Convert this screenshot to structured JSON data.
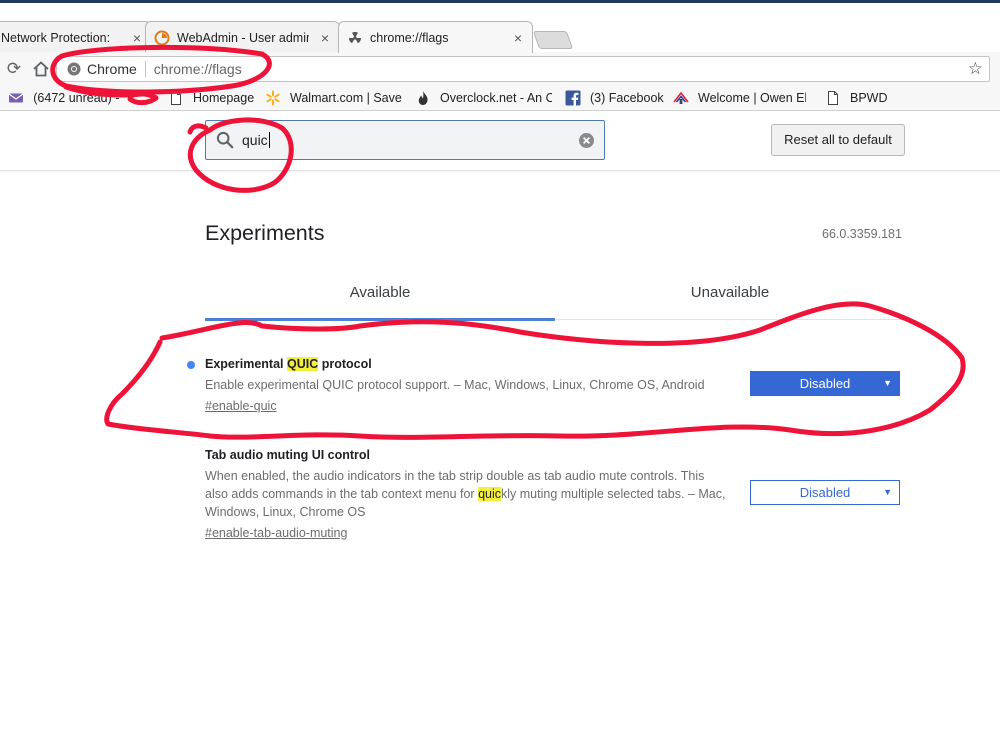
{
  "tabs": [
    {
      "title": "Network Protection: F",
      "close": "×"
    },
    {
      "title": "WebAdmin - User admin",
      "close": "×"
    },
    {
      "title": "chrome://flags",
      "close": "×"
    }
  ],
  "omnibox": {
    "site_label": "Chrome",
    "url": "chrome://flags"
  },
  "bookmarks": [
    {
      "label": "(6472 unread) -",
      "icon": "mail-icon"
    },
    {
      "label": "Homepage",
      "icon": "page-icon"
    },
    {
      "label": "Walmart.com | Save",
      "icon": "walmart-spark-icon"
    },
    {
      "label": "Overclock.net - An O",
      "icon": "flame-icon"
    },
    {
      "label": "(3) Facebook",
      "icon": "facebook-icon"
    },
    {
      "label": "Welcome | Owen Ele",
      "icon": "owen-logo-icon"
    },
    {
      "label": "BPWD",
      "icon": "page-icon"
    }
  ],
  "search": {
    "value": "quic"
  },
  "reset_label": "Reset all to default",
  "page": {
    "title": "Experiments",
    "version": "66.0.3359.181"
  },
  "flag_tabs": {
    "available": "Available",
    "unavailable": "Unavailable"
  },
  "experiments": [
    {
      "name_before": "Experimental ",
      "name_highlight": "QUIC",
      "name_after": " protocol",
      "description": "Enable experimental QUIC protocol support. – Mac, Windows, Linux, Chrome OS, Android",
      "link": "#enable-quic",
      "state": "Disabled",
      "modified": true
    },
    {
      "name": "Tab audio muting UI control",
      "desc_before": "When enabled, the audio indicators in the tab strip double as tab audio mute controls. This also adds commands in the tab context menu for ",
      "desc_highlight": "quic",
      "desc_after": "kly muting multiple selected tabs. – Mac, Windows, Linux, Chrome OS",
      "link": "#enable-tab-audio-muting",
      "state": "Disabled",
      "modified": false
    }
  ],
  "colors": {
    "accent": "#3568d4",
    "highlight": "#f3f03c",
    "marker": "#ee1439",
    "modified_dot": "#4285f4"
  }
}
